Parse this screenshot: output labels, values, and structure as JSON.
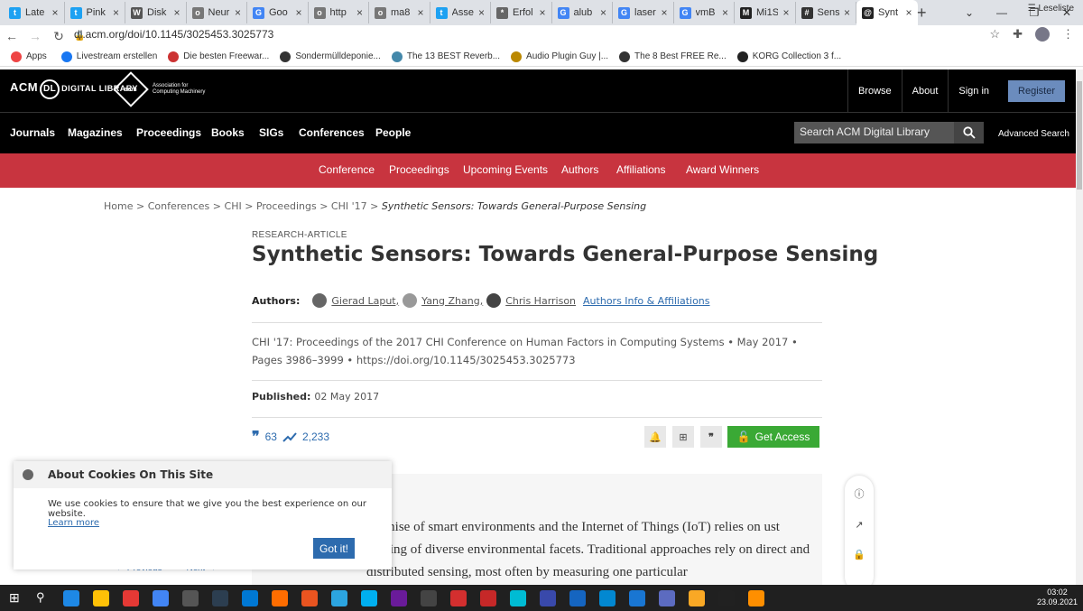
{
  "browser": {
    "tabs": [
      {
        "label": "Late",
        "color": "#1da1f2",
        "glyph": "t"
      },
      {
        "label": "Pink",
        "color": "#1da1f2",
        "glyph": "t"
      },
      {
        "label": "Disk",
        "color": "#555555",
        "glyph": "W"
      },
      {
        "label": "Neur",
        "color": "#777777",
        "glyph": "o"
      },
      {
        "label": "Goo",
        "color": "#4285f4",
        "glyph": "G"
      },
      {
        "label": "http",
        "color": "#777777",
        "glyph": "o"
      },
      {
        "label": "ma8",
        "color": "#777777",
        "glyph": "o"
      },
      {
        "label": "Asse",
        "color": "#1da1f2",
        "glyph": "t"
      },
      {
        "label": "Erfol",
        "color": "#666666",
        "glyph": "*"
      },
      {
        "label": "alub",
        "color": "#4285f4",
        "glyph": "G"
      },
      {
        "label": "laser",
        "color": "#4285f4",
        "glyph": "G"
      },
      {
        "label": "vmB",
        "color": "#4285f4",
        "glyph": "G"
      },
      {
        "label": "Mi1S",
        "color": "#222222",
        "glyph": "M"
      },
      {
        "label": "Sens",
        "color": "#333333",
        "glyph": "#"
      },
      {
        "label": "Synt",
        "color": "#222222",
        "glyph": "@"
      }
    ],
    "url": "dl.acm.org/doi/10.1145/3025453.3025773",
    "bookmarks": [
      {
        "label": "Apps",
        "color": "#e44"
      },
      {
        "label": "Livestream erstellen",
        "color": "#1877f2"
      },
      {
        "label": "Die besten Freewar...",
        "color": "#c33"
      },
      {
        "label": "Sondermülldeponie...",
        "color": "#333"
      },
      {
        "label": "The 13 BEST Reverb...",
        "color": "#48a"
      },
      {
        "label": "Audio Plugin Guy |...",
        "color": "#b80"
      },
      {
        "label": "The 8 Best FREE Re...",
        "color": "#333"
      },
      {
        "label": "KORG Collection 3 f...",
        "color": "#222"
      }
    ],
    "leseliste": "Leseliste"
  },
  "acm": {
    "logo": {
      "left": "ACM",
      "dl": "DL",
      "right": "DIGITAL LIBRARY"
    },
    "assoc": {
      "badge": "acm",
      "line1": "Association for",
      "line2": "Computing Machinery"
    },
    "topnav": [
      "Browse",
      "About",
      "Sign in"
    ],
    "register": "Register",
    "mainnav": [
      "Journals",
      "Magazines",
      "Proceedings",
      "Books",
      "SIGs",
      "Conferences",
      "People"
    ],
    "search_placeholder": "Search ACM Digital Library",
    "advanced_search": "Advanced Search",
    "subnav": [
      "Conference",
      "Proceedings",
      "Upcoming Events",
      "Authors",
      "Affiliations",
      "Award Winners"
    ]
  },
  "breadcrumb": {
    "items": [
      "Home",
      "Conferences",
      "CHI",
      "Proceedings",
      "CHI '17"
    ],
    "current": "Synthetic Sensors: Towards General-Purpose Sensing"
  },
  "article": {
    "type": "RESEARCH-ARTICLE",
    "title": "Synthetic Sensors: Towards General-Purpose Sensing",
    "authors_label": "Authors:",
    "authors": [
      "Gierad Laput,",
      "Yang Zhang,",
      "Chris Harrison"
    ],
    "authors_info": "Authors Info & Affiliations",
    "pubinfo": "CHI '17: Proceedings of the 2017 CHI Conference on Human Factors in Computing Systems • May 2017 • Pages 3986–3999 • https://doi.org/10.1145/3025453.3025773",
    "published_label": "Published:",
    "published_date": "02 May 2017",
    "citations": "63",
    "downloads": "2,233",
    "get_access": "Get Access",
    "abstract": "promise of smart environments and the Internet of Things (IoT) relies on ust sensing of diverse environmental facets. Traditional approaches rely on direct and distributed sensing, most often by measuring one particular",
    "pager_prev": "← Previous",
    "pager_next": "Next →"
  },
  "cookie": {
    "title": "About Cookies On This Site",
    "text": "We use cookies to ensure that we give you the best experience on our website.",
    "learn_more": "Learn more",
    "button": "Got it!"
  },
  "taskbar": {
    "icons": [
      "#1e88e5",
      "#ffc107",
      "#e53935",
      "#4285f4",
      "#555555",
      "#2c3e50",
      "#0078d4",
      "#ff6d00",
      "#e95420",
      "#2ca5e0",
      "#00aff0",
      "#6a1b9a",
      "#444444",
      "#d32f2f",
      "#c62828",
      "#00bcd4",
      "#3949ab",
      "#1565c0",
      "#0288d1",
      "#1976d2",
      "#5c6bc0",
      "#f9a825",
      "#212121",
      "#ff8f00"
    ],
    "time": "03:02",
    "date": "23.09.2021"
  }
}
